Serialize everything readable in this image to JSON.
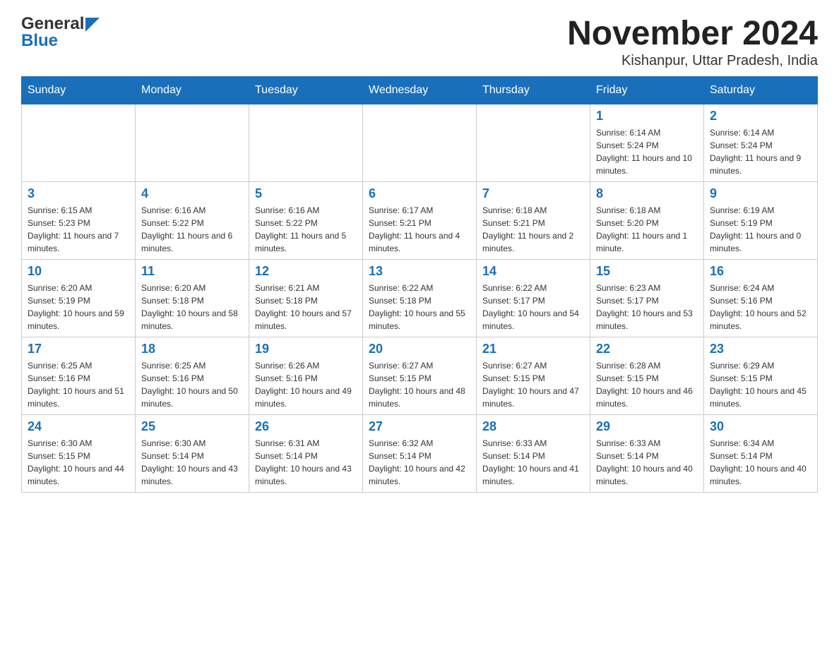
{
  "header": {
    "logo_general": "General",
    "logo_blue": "Blue",
    "month_title": "November 2024",
    "location": "Kishanpur, Uttar Pradesh, India"
  },
  "days_of_week": [
    "Sunday",
    "Monday",
    "Tuesday",
    "Wednesday",
    "Thursday",
    "Friday",
    "Saturday"
  ],
  "weeks": [
    [
      {
        "day": "",
        "info": ""
      },
      {
        "day": "",
        "info": ""
      },
      {
        "day": "",
        "info": ""
      },
      {
        "day": "",
        "info": ""
      },
      {
        "day": "",
        "info": ""
      },
      {
        "day": "1",
        "info": "Sunrise: 6:14 AM\nSunset: 5:24 PM\nDaylight: 11 hours and 10 minutes."
      },
      {
        "day": "2",
        "info": "Sunrise: 6:14 AM\nSunset: 5:24 PM\nDaylight: 11 hours and 9 minutes."
      }
    ],
    [
      {
        "day": "3",
        "info": "Sunrise: 6:15 AM\nSunset: 5:23 PM\nDaylight: 11 hours and 7 minutes."
      },
      {
        "day": "4",
        "info": "Sunrise: 6:16 AM\nSunset: 5:22 PM\nDaylight: 11 hours and 6 minutes."
      },
      {
        "day": "5",
        "info": "Sunrise: 6:16 AM\nSunset: 5:22 PM\nDaylight: 11 hours and 5 minutes."
      },
      {
        "day": "6",
        "info": "Sunrise: 6:17 AM\nSunset: 5:21 PM\nDaylight: 11 hours and 4 minutes."
      },
      {
        "day": "7",
        "info": "Sunrise: 6:18 AM\nSunset: 5:21 PM\nDaylight: 11 hours and 2 minutes."
      },
      {
        "day": "8",
        "info": "Sunrise: 6:18 AM\nSunset: 5:20 PM\nDaylight: 11 hours and 1 minute."
      },
      {
        "day": "9",
        "info": "Sunrise: 6:19 AM\nSunset: 5:19 PM\nDaylight: 11 hours and 0 minutes."
      }
    ],
    [
      {
        "day": "10",
        "info": "Sunrise: 6:20 AM\nSunset: 5:19 PM\nDaylight: 10 hours and 59 minutes."
      },
      {
        "day": "11",
        "info": "Sunrise: 6:20 AM\nSunset: 5:18 PM\nDaylight: 10 hours and 58 minutes."
      },
      {
        "day": "12",
        "info": "Sunrise: 6:21 AM\nSunset: 5:18 PM\nDaylight: 10 hours and 57 minutes."
      },
      {
        "day": "13",
        "info": "Sunrise: 6:22 AM\nSunset: 5:18 PM\nDaylight: 10 hours and 55 minutes."
      },
      {
        "day": "14",
        "info": "Sunrise: 6:22 AM\nSunset: 5:17 PM\nDaylight: 10 hours and 54 minutes."
      },
      {
        "day": "15",
        "info": "Sunrise: 6:23 AM\nSunset: 5:17 PM\nDaylight: 10 hours and 53 minutes."
      },
      {
        "day": "16",
        "info": "Sunrise: 6:24 AM\nSunset: 5:16 PM\nDaylight: 10 hours and 52 minutes."
      }
    ],
    [
      {
        "day": "17",
        "info": "Sunrise: 6:25 AM\nSunset: 5:16 PM\nDaylight: 10 hours and 51 minutes."
      },
      {
        "day": "18",
        "info": "Sunrise: 6:25 AM\nSunset: 5:16 PM\nDaylight: 10 hours and 50 minutes."
      },
      {
        "day": "19",
        "info": "Sunrise: 6:26 AM\nSunset: 5:16 PM\nDaylight: 10 hours and 49 minutes."
      },
      {
        "day": "20",
        "info": "Sunrise: 6:27 AM\nSunset: 5:15 PM\nDaylight: 10 hours and 48 minutes."
      },
      {
        "day": "21",
        "info": "Sunrise: 6:27 AM\nSunset: 5:15 PM\nDaylight: 10 hours and 47 minutes."
      },
      {
        "day": "22",
        "info": "Sunrise: 6:28 AM\nSunset: 5:15 PM\nDaylight: 10 hours and 46 minutes."
      },
      {
        "day": "23",
        "info": "Sunrise: 6:29 AM\nSunset: 5:15 PM\nDaylight: 10 hours and 45 minutes."
      }
    ],
    [
      {
        "day": "24",
        "info": "Sunrise: 6:30 AM\nSunset: 5:15 PM\nDaylight: 10 hours and 44 minutes."
      },
      {
        "day": "25",
        "info": "Sunrise: 6:30 AM\nSunset: 5:14 PM\nDaylight: 10 hours and 43 minutes."
      },
      {
        "day": "26",
        "info": "Sunrise: 6:31 AM\nSunset: 5:14 PM\nDaylight: 10 hours and 43 minutes."
      },
      {
        "day": "27",
        "info": "Sunrise: 6:32 AM\nSunset: 5:14 PM\nDaylight: 10 hours and 42 minutes."
      },
      {
        "day": "28",
        "info": "Sunrise: 6:33 AM\nSunset: 5:14 PM\nDaylight: 10 hours and 41 minutes."
      },
      {
        "day": "29",
        "info": "Sunrise: 6:33 AM\nSunset: 5:14 PM\nDaylight: 10 hours and 40 minutes."
      },
      {
        "day": "30",
        "info": "Sunrise: 6:34 AM\nSunset: 5:14 PM\nDaylight: 10 hours and 40 minutes."
      }
    ]
  ]
}
